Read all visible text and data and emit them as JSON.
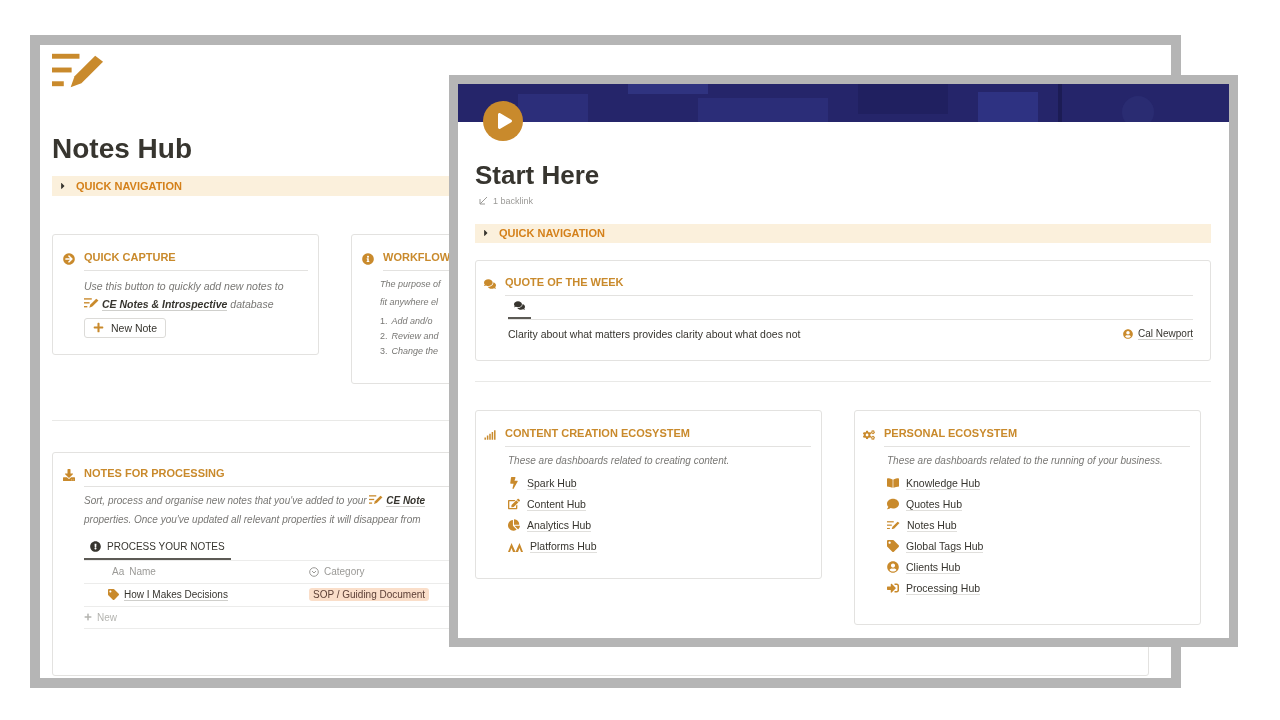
{
  "back_window": {
    "title": "Notes Hub",
    "quick_nav": {
      "label": "QUICK NAVIGATION",
      "expanded": false
    },
    "quick_capture": {
      "heading": "QUICK CAPTURE",
      "text_before": "Use this button to quickly add new notes to",
      "link": "CE Notes & Introspective",
      "text_after": "database",
      "button": "New Note"
    },
    "workflow": {
      "heading": "WORKFLOW",
      "lines": [
        "The purpose of",
        "fit anywhere el"
      ],
      "steps": [
        {
          "number": "1.",
          "text": "Add and/o"
        },
        {
          "number": "2.",
          "text": "Review and"
        },
        {
          "number": "3.",
          "text": "Change the"
        }
      ]
    },
    "processing": {
      "heading": "NOTES FOR PROCESSING",
      "text_before": "Sort, process and organise new notes that you've added to your",
      "link": "CE Note",
      "text_line2": "properties. Once you've updated all relevant properties it will disappear from",
      "tabs": [
        {
          "label": "PROCESS YOUR NOTES",
          "selected": true
        }
      ],
      "columns": [
        {
          "icon_text": "Aa",
          "label": "Name"
        },
        {
          "label": "Category"
        }
      ],
      "rows": [
        {
          "name": "How I Makes Decisions",
          "category": "SOP / Guiding Document"
        }
      ],
      "add_row": "New"
    }
  },
  "front_window": {
    "title": "Start Here",
    "backlink": "1 backlink",
    "quick_nav": {
      "label": "QUICK NAVIGATION",
      "expanded": false
    },
    "quote": {
      "heading": "QUOTE OF THE WEEK",
      "tabs": [
        {
          "selected": true
        }
      ],
      "text": "Clarity about what matters provides clarity about what does not",
      "author": "Cal Newport"
    },
    "sections": [
      {
        "heading": "CONTENT CREATION ECOSYSTEM",
        "description": "These are dashboards related to creating content.",
        "links": [
          "Spark Hub",
          "Content Hub",
          "Analytics Hub",
          "Platforms Hub"
        ]
      },
      {
        "heading": "PERSONAL ECOSYSTEM",
        "description": "These are dashboards related to the running of your business.",
        "links": [
          "Knowledge Hub",
          "Quotes Hub",
          "Notes Hub",
          "Global Tags Hub",
          "Clients Hub",
          "Processing Hub"
        ]
      }
    ]
  }
}
